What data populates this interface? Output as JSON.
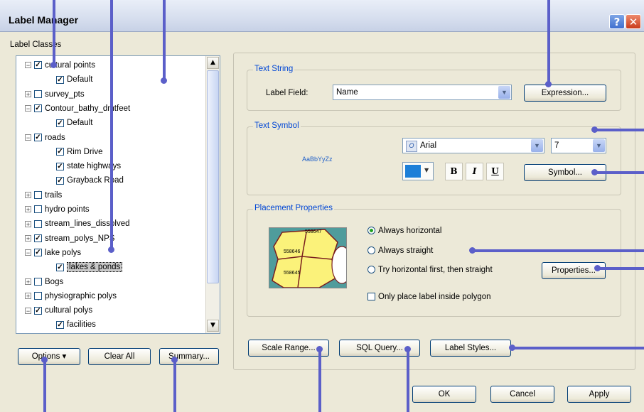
{
  "window": {
    "title": "Label Manager",
    "help_glyph": "?",
    "close_glyph": "✕"
  },
  "label_classes": {
    "heading": "Label Classes",
    "tree": [
      {
        "label": "cultural points",
        "level": 0,
        "expander": "−",
        "checked": true
      },
      {
        "label": "Default",
        "level": 1,
        "checked": true
      },
      {
        "label": "survey_pts",
        "level": 0,
        "expander": "+",
        "checked": false
      },
      {
        "label": "Contour_bathy_dmtfeet",
        "level": 0,
        "expander": "−",
        "checked": true
      },
      {
        "label": "Default",
        "level": 1,
        "checked": true
      },
      {
        "label": "roads",
        "level": 0,
        "expander": "−",
        "checked": true
      },
      {
        "label": "Rim Drive",
        "level": 1,
        "checked": true
      },
      {
        "label": "state highways",
        "level": 1,
        "checked": true
      },
      {
        "label": "Grayback Road",
        "level": 1,
        "checked": true
      },
      {
        "label": "trails",
        "level": 0,
        "expander": "+",
        "checked": false
      },
      {
        "label": "hydro points",
        "level": 0,
        "expander": "+",
        "checked": false
      },
      {
        "label": "stream_lines_dissolved",
        "level": 0,
        "expander": "+",
        "checked": false
      },
      {
        "label": "stream_polys_NPS",
        "level": 0,
        "expander": "+",
        "checked": true
      },
      {
        "label": "lake polys",
        "level": 0,
        "expander": "−",
        "checked": true
      },
      {
        "label": "lakes & ponds",
        "level": 1,
        "checked": true,
        "selected": true
      },
      {
        "label": "Bogs",
        "level": 0,
        "expander": "+",
        "checked": false
      },
      {
        "label": "physiographic polys",
        "level": 0,
        "expander": "+",
        "checked": false
      },
      {
        "label": "cultural polys",
        "level": 0,
        "expander": "−",
        "checked": true
      },
      {
        "label": "facilities",
        "level": 1,
        "checked": true
      }
    ],
    "buttons": {
      "options": "Options",
      "clear_all": "Clear All",
      "summary": "Summary..."
    }
  },
  "text_string": {
    "group_title": "Text String",
    "label_field_label": "Label Field:",
    "label_field_value": "Name",
    "expression_button": "Expression..."
  },
  "text_symbol": {
    "group_title": "Text Symbol",
    "preview_text": "AaBbYyZz",
    "preview_color": "#1e5fc9",
    "font_value": "Arial",
    "font_icon_glyph": "O",
    "size_value": "7",
    "text_color": "#1c7fd8",
    "bold_glyph": "B",
    "italic_glyph": "I",
    "underline_glyph": "U",
    "symbol_button": "Symbol..."
  },
  "placement": {
    "group_title": "Placement Properties",
    "preview_labels": [
      "558647",
      "558646",
      "558645"
    ],
    "options": [
      {
        "label": "Always horizontal",
        "selected": true
      },
      {
        "label": "Always straight",
        "selected": false
      },
      {
        "label": "Try horizontal first, then straight",
        "selected": false
      }
    ],
    "properties_button": "Properties...",
    "inside_polygon_label": "Only place label inside polygon",
    "inside_polygon_checked": false
  },
  "bottom_buttons": {
    "scale_range": "Scale Range...",
    "sql_query": "SQL Query...",
    "label_styles": "Label Styles..."
  },
  "dialog_buttons": {
    "ok": "OK",
    "cancel": "Cancel",
    "apply": "Apply"
  },
  "callout_color": "#5b5fc9"
}
